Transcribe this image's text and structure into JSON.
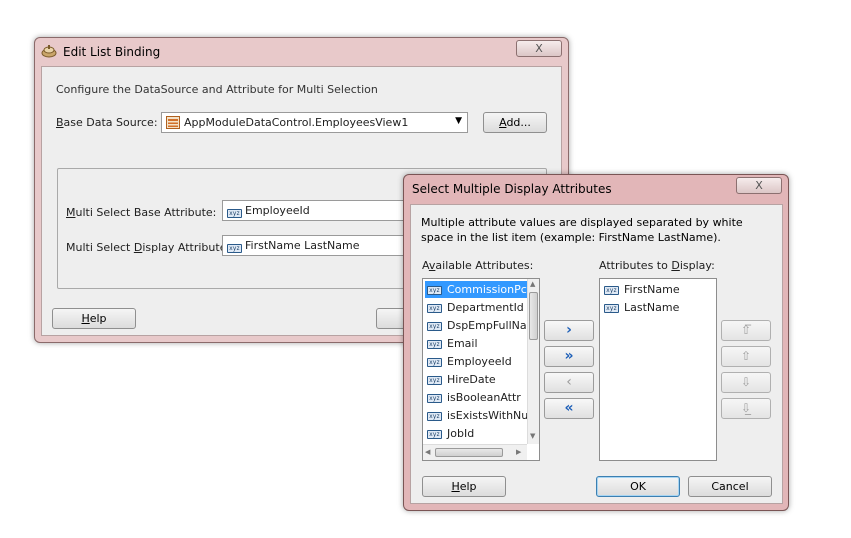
{
  "edit_dialog": {
    "title": "Edit List Binding",
    "close_glyph": "X",
    "description": "Configure the DataSource and Attribute for Multi Selection",
    "base_ds_label_key": "B",
    "base_ds_label_rest": "ase Data Source:",
    "base_ds_value": "AppModuleDataControl.EmployeesView1",
    "add_key": "A",
    "add_rest": "dd...",
    "base_attr_label_key": "M",
    "base_attr_label_rest": "ulti Select Base Attribute:",
    "base_attr_value": "EmployeeId",
    "display_attr_label_pre": "Multi Select ",
    "display_attr_label_key": "D",
    "display_attr_label_rest": "isplay Attribute:",
    "display_attr_value": "FirstName LastName",
    "help_key": "H",
    "help_rest": "elp"
  },
  "select_dialog": {
    "title": "Select Multiple Display Attributes",
    "close_glyph": "X",
    "description": "Multiple attribute values are displayed separated by white space in the list item (example: FirstName LastName).",
    "available_label_pre": "A",
    "available_label_key": "v",
    "available_label_rest": "ailable Attributes:",
    "display_label_pre": "Attributes to ",
    "display_label_key": "D",
    "display_label_rest": "isplay:",
    "available_items": [
      {
        "label": "CommissionPct",
        "selected": true
      },
      {
        "label": "DepartmentId",
        "selected": false
      },
      {
        "label": "DspEmpFullName",
        "selected": false
      },
      {
        "label": "Email",
        "selected": false
      },
      {
        "label": "EmployeeId",
        "selected": false
      },
      {
        "label": "HireDate",
        "selected": false
      },
      {
        "label": "isBooleanAttr",
        "selected": false
      },
      {
        "label": "isExistsWithNumb",
        "selected": false
      },
      {
        "label": "JobId",
        "selected": false
      }
    ],
    "display_items": [
      {
        "label": "FirstName"
      },
      {
        "label": "LastName"
      }
    ],
    "help_key": "H",
    "help_rest": "elp",
    "ok_label": "OK",
    "cancel_label": "Cancel"
  },
  "colors": {
    "window_frame": "#e8c9ca",
    "selection": "#3399ff"
  },
  "icons": {
    "attribute_icon": "attribute-icon",
    "data_source_icon": "view-object-icon",
    "app_icon": "jdeveloper-icon"
  }
}
